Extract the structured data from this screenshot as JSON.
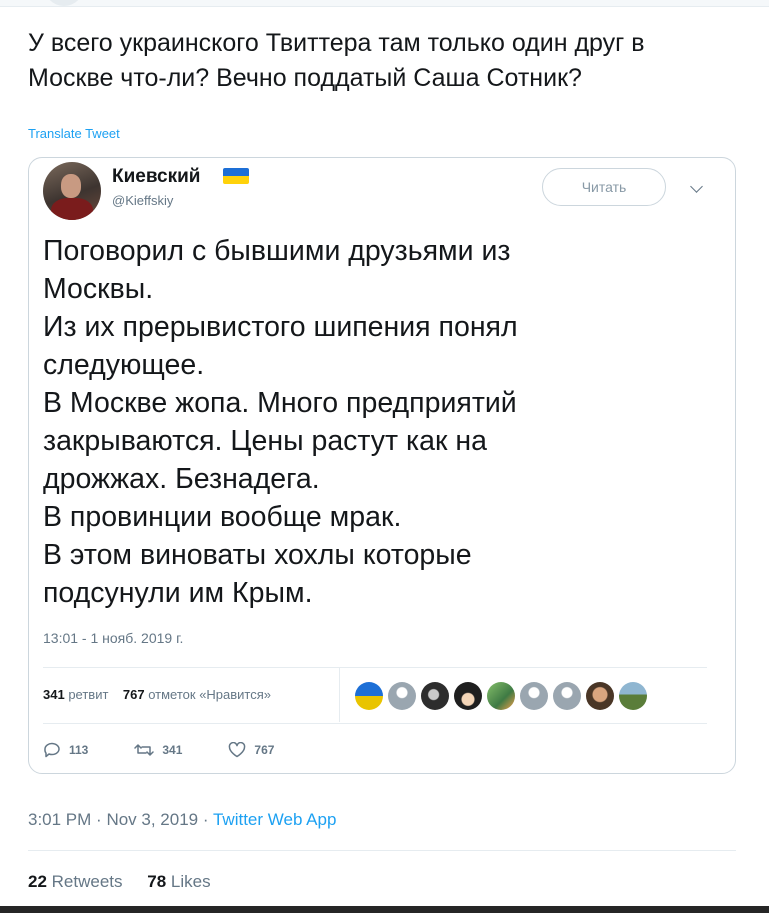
{
  "tweet": {
    "text": "У всего украинского Твиттера там только один друг в\nМоскве что-ли? Вечно поддатый Саша Сотник?",
    "translate_label": "Translate Tweet",
    "time": "3:01 PM",
    "date": "Nov 3, 2019",
    "separator": "·",
    "source": "Twitter Web App",
    "retweets_count": "22",
    "retweets_label": "Retweets",
    "likes_count": "78",
    "likes_label": "Likes"
  },
  "quoted": {
    "display_name": "Киевский",
    "flag_icon": "ukraine-flag-icon",
    "handle": "@Kieffskiy",
    "follow_label": "Читать",
    "text": "Поговорил с бывшими друзьями из\nМосквы.\nИз их прерывистого шипения понял\nследующее.\nВ Москве жопа. Много предприятий\nзакрываются. Цены растут как на\nдрожжах. Безнадега.\nВ провинции вообще мрак.\nВ этом виноваты хохлы которые\nподсунули им Крым.",
    "timestamp": "13:01 - 1 нояб. 2019 г.",
    "retweets_count": "341",
    "retweets_label": "ретвит",
    "likes_count": "767",
    "likes_label": "отметок «Нравится»",
    "liker_avatars": [
      "ukraine-flag-avatar",
      "default-avatar",
      "dark-avatar",
      "hat-avatar",
      "bus-avatar",
      "default-avatar",
      "default-avatar",
      "man-avatar",
      "landscape-avatar"
    ],
    "reply_count": "113",
    "retweet_count": "341",
    "like_count": "767"
  },
  "colors": {
    "link": "#1da1f2",
    "muted": "#657786",
    "text": "#14171a",
    "border": "#ccd6dd"
  }
}
